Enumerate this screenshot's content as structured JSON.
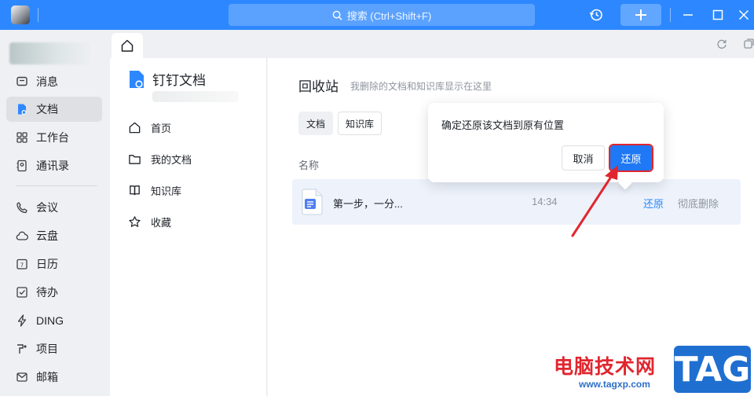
{
  "titlebar": {
    "search_placeholder": "搜索 (Ctrl+Shift+F)",
    "accent": "#2d88ff"
  },
  "leftnav": {
    "items": [
      {
        "label": "消息",
        "icon": "message-icon"
      },
      {
        "label": "文档",
        "icon": "doc-icon",
        "active": true
      },
      {
        "label": "工作台",
        "icon": "grid-icon"
      },
      {
        "label": "通讯录",
        "icon": "contacts-icon"
      },
      {
        "label": "会议",
        "icon": "phone-icon"
      },
      {
        "label": "云盘",
        "icon": "cloud-icon"
      },
      {
        "label": "日历",
        "icon": "calendar-icon"
      },
      {
        "label": "待办",
        "icon": "todo-icon"
      },
      {
        "label": "DING",
        "icon": "lightning-icon"
      },
      {
        "label": "项目",
        "icon": "project-icon"
      },
      {
        "label": "邮箱",
        "icon": "mail-icon"
      }
    ]
  },
  "docside": {
    "title": "钉钉文档",
    "items": [
      {
        "label": "首页",
        "icon": "home-icon"
      },
      {
        "label": "我的文档",
        "icon": "folder-icon"
      },
      {
        "label": "知识库",
        "icon": "book-icon"
      },
      {
        "label": "收藏",
        "icon": "star-icon"
      }
    ]
  },
  "main": {
    "title": "回收站",
    "subtitle": "我删除的文档和知识库显示在这里",
    "tabs": [
      {
        "label": "文档",
        "active": true
      },
      {
        "label": "知识库",
        "active": false
      }
    ],
    "column_name": "名称",
    "row": {
      "name": "第一步，一分...",
      "time": "14:34",
      "restore": "还原",
      "purge": "彻底删除"
    }
  },
  "popover": {
    "message": "确定还原该文档到原有位置",
    "cancel": "取消",
    "confirm": "还原"
  },
  "watermark": {
    "text": "电脑技术网",
    "url": "www.tagxp.com",
    "tag": "TAG"
  }
}
